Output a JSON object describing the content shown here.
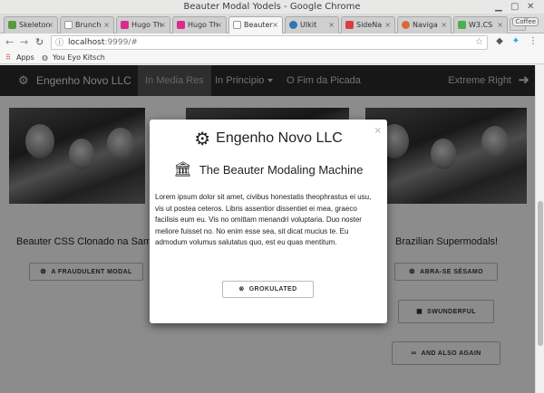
{
  "window": {
    "title": "Beauter Modal Yodels - Google Chrome",
    "profile": "Coffee"
  },
  "tabs": [
    {
      "label": "Skeleton",
      "color": "#5a9a3f"
    },
    {
      "label": "Brunch",
      "color": "#888888"
    },
    {
      "label": "Hugo Th",
      "color": "#d92b8c"
    },
    {
      "label": "Hugo Th",
      "color": "#d92b8c"
    },
    {
      "label": "Beauter",
      "color": "#9a9a9a"
    },
    {
      "label": "UIkit",
      "color": "#2f75b5"
    },
    {
      "label": "SideNa",
      "color": "#d84040"
    },
    {
      "label": "Naviga",
      "color": "#d86a3a"
    },
    {
      "label": "W3.CS",
      "color": "#4caf50"
    }
  ],
  "toolbar": {
    "url_host": "localhost",
    "url_path": ":9999/#"
  },
  "bookmarks": {
    "apps": "Apps",
    "item": "You Eyo Kitsch"
  },
  "nav": {
    "brand": "Engenho Novo LLC",
    "links": [
      "In Media Res",
      "In Principio",
      "O Fim da Picada"
    ],
    "right": "Extreme Right"
  },
  "cards": [
    {
      "title": "Beauter CSS Clonado na Samba"
    },
    {
      "title": ""
    },
    {
      "title": "Brazilian Supermodals!"
    }
  ],
  "buttons": {
    "fraudulent": "A FRAUDULENT MODAL",
    "abra": "ABRA-SE SÉSAMO",
    "swunderful": "SWUNDERFUL",
    "also_again": "AND ALSO AGAIN"
  },
  "modal": {
    "title": "Engenho Novo LLC",
    "subtitle": "The Beauter Modaling Machine",
    "body": "Lorem ipsum dolor sit amet, civibus honestatis theophrastus ei usu, vis ut postea ceteros. Libris assentior dissentiet ei mea, graeco facilisis eum eu. Vis no omittam menandri voluptaria. Duo noster meliore fuisset no. No enim esse sea, sit dicat mucius te. Eu admodum volumus salutatus quo, est eu quas mentitum.",
    "button": "GROKULATED",
    "close": "×"
  }
}
